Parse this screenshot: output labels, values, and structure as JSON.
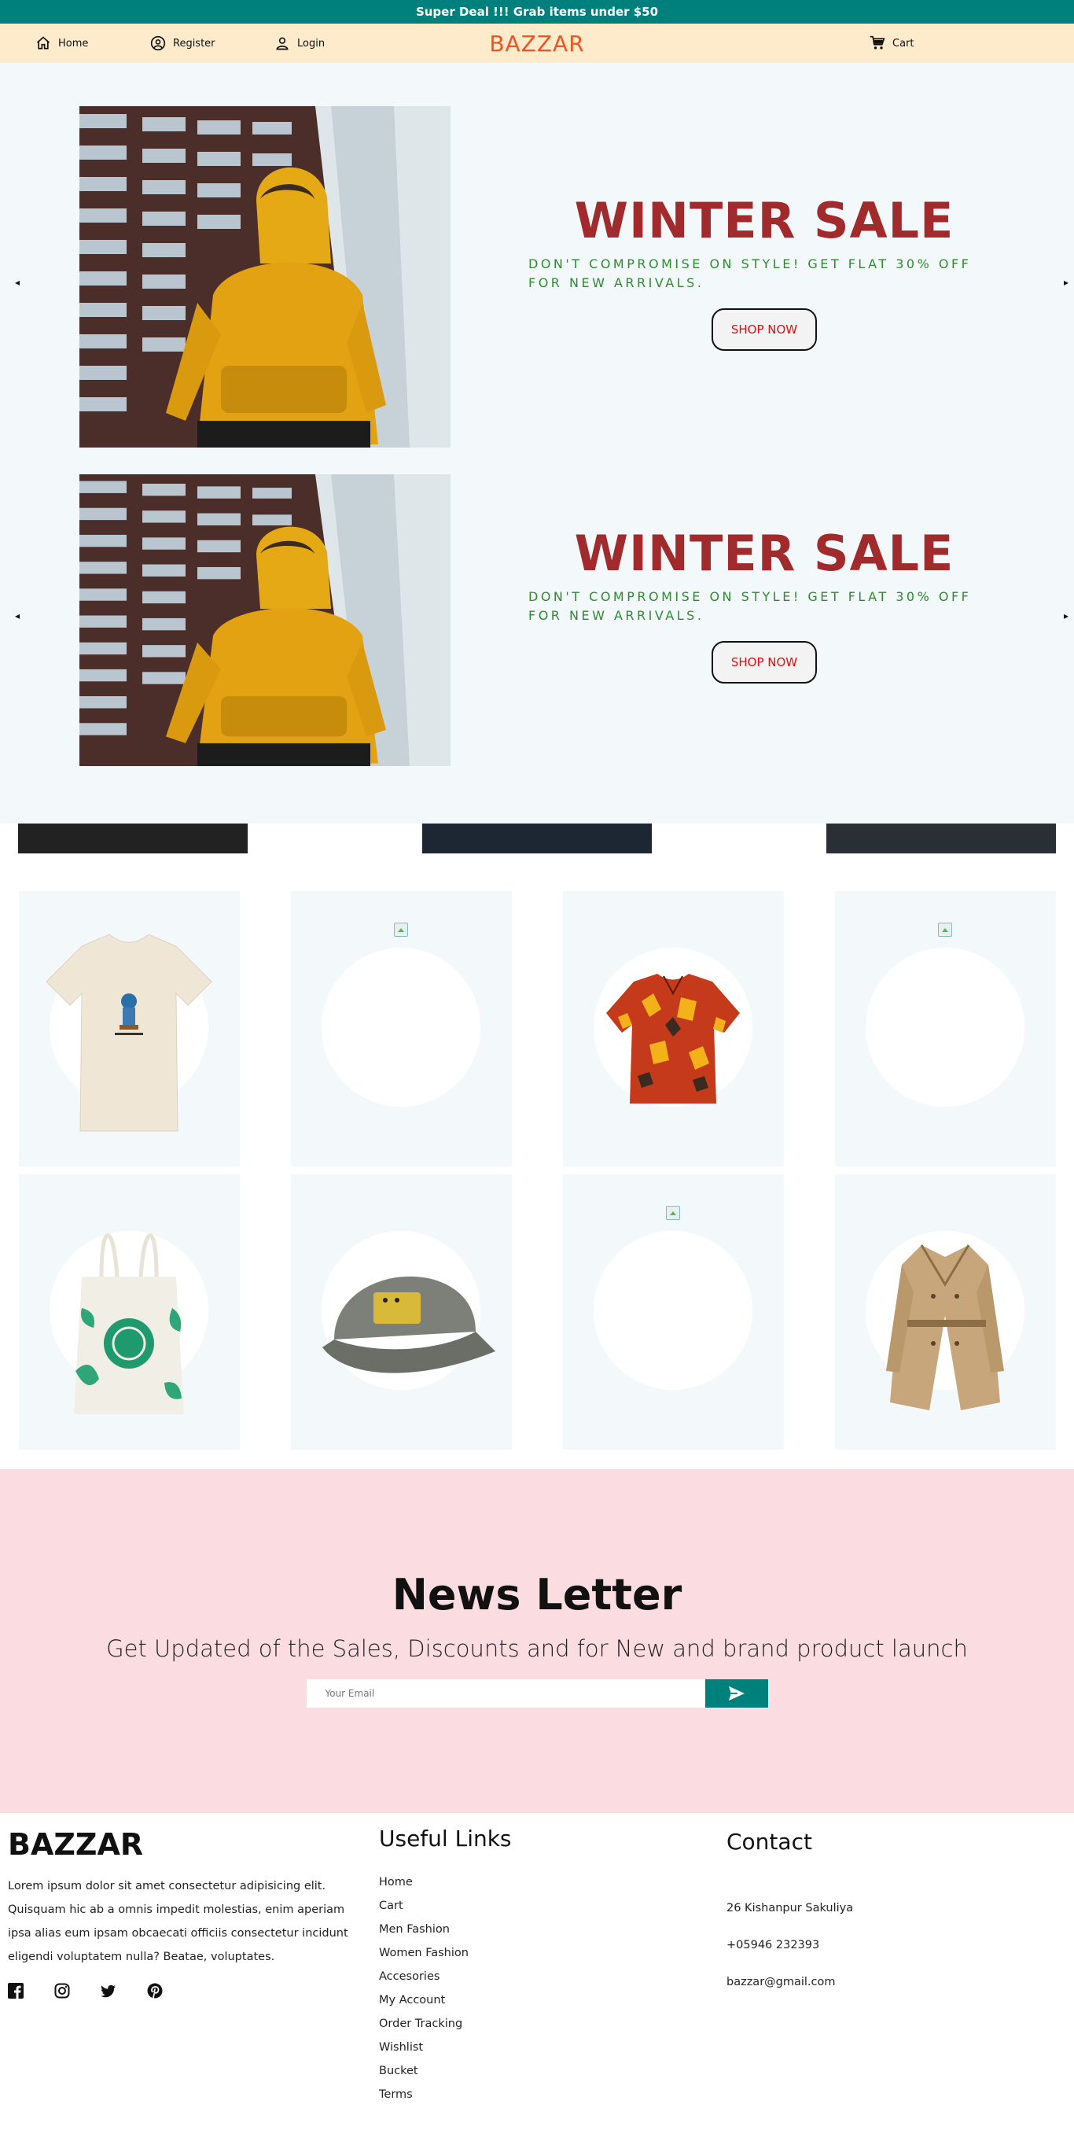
{
  "topbar": {
    "text": "Super Deal !!! Grab items under $50"
  },
  "nav": {
    "home": "Home",
    "register": "Register",
    "login": "Login",
    "brand": "BAZZAR",
    "cart": "Cart"
  },
  "hero": {
    "slides": [
      {
        "title": "WINTER SALE",
        "subtitle": "Don't compromise on style! Get flat 30% off for new arrivals.",
        "button": "SHOP NOW"
      },
      {
        "title": "WINTER SALE",
        "subtitle": "Don't compromise on style! Get flat 30% off for new arrivals.",
        "button": "SHOP NOW"
      }
    ],
    "arrow_left": "◂",
    "arrow_right": "▸"
  },
  "newsletter": {
    "title": "News Letter",
    "subtitle": "Get Updated of the Sales, Discounts and for New and brand product launch",
    "placeholder": "Your Email"
  },
  "footer": {
    "brand": "BAZZAR",
    "description": "Lorem ipsum dolor sit amet consectetur adipisicing elit. Quisquam hic ab a omnis impedit molestias, enim aperiam ipsa alias eum ipsam obcaecati officiis consectetur incidunt eligendi voluptatem nulla? Beatae, voluptates.",
    "links_title": "Useful Links",
    "links": [
      "Home",
      "Cart",
      "Men Fashion",
      "Women Fashion",
      "Accesories",
      "My Account",
      "Order Tracking",
      "Wishlist",
      "Bucket",
      "Terms"
    ],
    "contact_title": "Contact",
    "address": "26 Kishanpur Sakuliya",
    "phone": "+05946 232393",
    "email": "bazzar@gmail.com"
  },
  "colors": {
    "accent": "#00807c",
    "nav_bg": "#fdebcb",
    "brand": "#f0541e",
    "sale_title": "#a12a2c",
    "sale_sub": "#2f8a2f",
    "newsletter_bg": "#fbdce0"
  }
}
